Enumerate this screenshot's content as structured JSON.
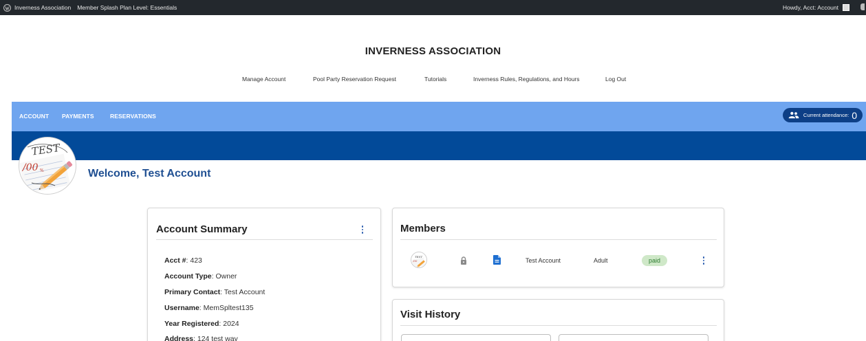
{
  "admin_bar": {
    "site_name": "Inverness Association",
    "plan_level": "Member Splash Plan Level: Essentials",
    "howdy": "Howdy, Acct: Account"
  },
  "site": {
    "title": "INVERNESS ASSOCIATION",
    "nav": [
      {
        "label": "Manage Account"
      },
      {
        "label": "Pool Party Reservation Request"
      },
      {
        "label": "Tutorials"
      },
      {
        "label": "Inverness Rules, Regulations, and Hours"
      },
      {
        "label": "Log Out"
      }
    ]
  },
  "app_bar": {
    "tabs": [
      {
        "label": "ACCOUNT",
        "active": true
      },
      {
        "label": "PAYMENTS",
        "active": false
      },
      {
        "label": "RESERVATIONS",
        "active": false
      }
    ],
    "attendance_label": "Current attendance:",
    "attendance_count": "0",
    "accent": "#6fa5ef",
    "banner_color": "#024a99"
  },
  "welcome": "Welcome, Test Account",
  "account_summary": {
    "title": "Account Summary",
    "fields": [
      {
        "label": "Acct #",
        "value": ": 423"
      },
      {
        "label": "Account Type",
        "value": ": Owner"
      },
      {
        "label": "Primary Contact",
        "value": ": Test Account"
      },
      {
        "label": "Username",
        "value": ": MemSpltest135"
      },
      {
        "label": "Year Registered",
        "value": ": 2024"
      },
      {
        "label": "Address",
        "value": ": 124 test way"
      }
    ]
  },
  "members": {
    "title": "Members",
    "rows": [
      {
        "name": "Test Account",
        "type": "Adult",
        "status": "paid",
        "icons": [
          "avatar",
          "lock-icon",
          "document-icon"
        ]
      }
    ]
  },
  "visit_history": {
    "title": "Visit History"
  }
}
